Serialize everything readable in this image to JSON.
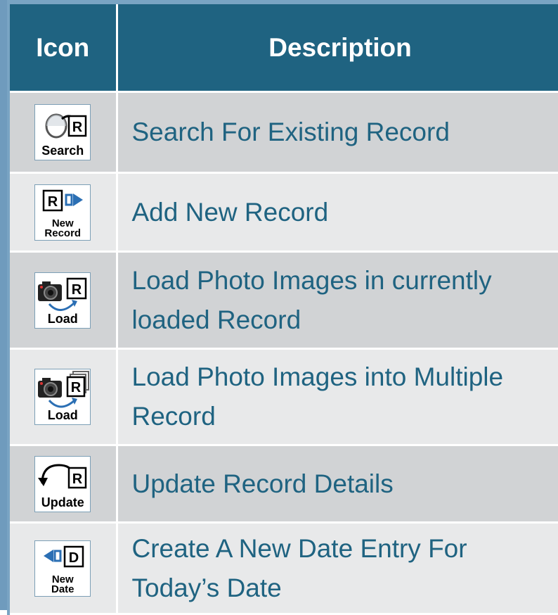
{
  "table": {
    "headers": {
      "icon": "Icon",
      "description": "Description"
    },
    "rows": [
      {
        "icon": "search-record-icon",
        "label_lines": [
          "Search"
        ],
        "description": "Search For Existing Record"
      },
      {
        "icon": "new-record-icon",
        "label_lines": [
          "New",
          "Record"
        ],
        "description": "Add New Record"
      },
      {
        "icon": "load-photo-icon",
        "label_lines": [
          "Load"
        ],
        "description": "Load Photo Images in currently loaded Record"
      },
      {
        "icon": "load-photo-multiple-icon",
        "label_lines": [
          "Load"
        ],
        "description": "Load Photo Images into Multiple Record"
      },
      {
        "icon": "update-record-icon",
        "label_lines": [
          "Update"
        ],
        "description": "Update Record Details"
      },
      {
        "icon": "new-date-icon",
        "label_lines": [
          "New",
          "Date"
        ],
        "description": "Create A New Date Entry For Today’s Date"
      }
    ]
  },
  "colors": {
    "header_bg": "#1f6381",
    "row_odd_bg": "#d1d3d5",
    "row_even_bg": "#e8e9ea",
    "description_text": "#1f6381",
    "arrow_blue": "#2b6fb4"
  }
}
